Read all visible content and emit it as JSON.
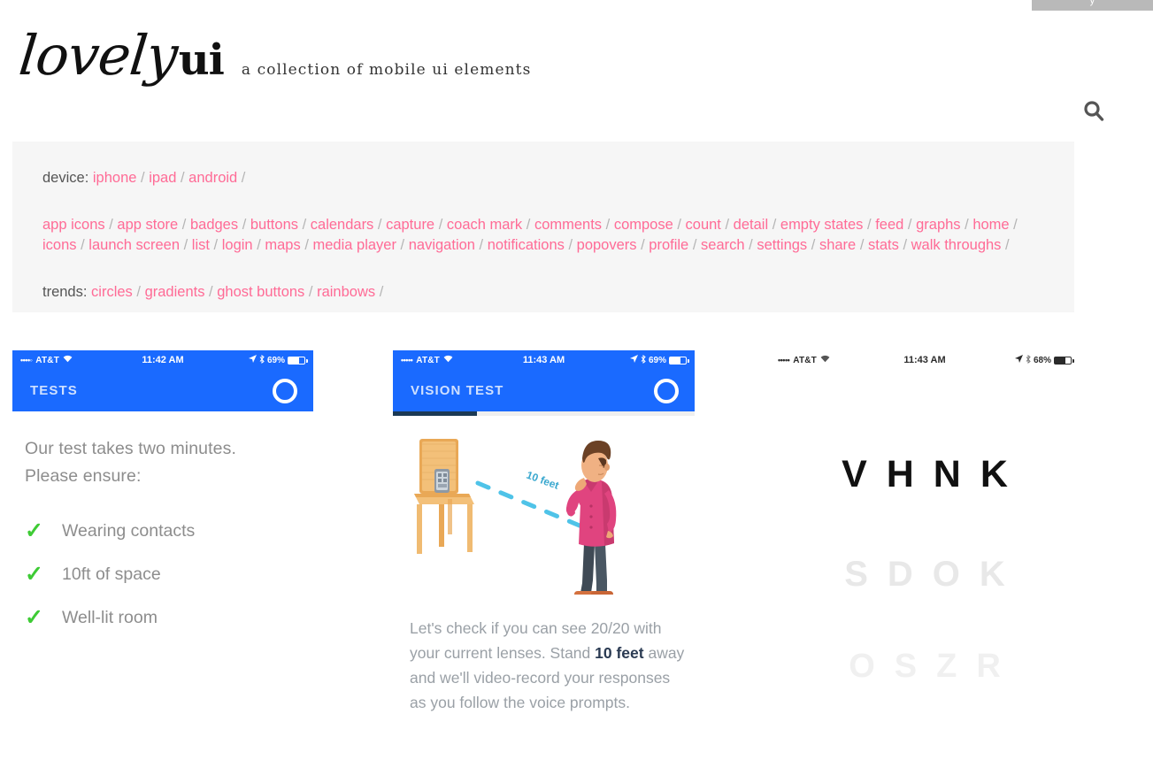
{
  "topbar": {
    "cut_label": "y"
  },
  "header": {
    "logo_script": "lovely",
    "logo_bold": "ui",
    "tagline": "a collection of mobile ui elements",
    "search_icon": "search-icon"
  },
  "nav": {
    "device_label": "device:",
    "device_links": [
      "iphone",
      "ipad",
      "android"
    ],
    "category_links": [
      "app icons",
      "app store",
      "badges",
      "buttons",
      "calendars",
      "capture",
      "coach mark",
      "comments",
      "compose",
      "count",
      "detail",
      "empty states",
      "feed",
      "graphs",
      "home",
      "icons",
      "launch screen",
      "list",
      "login",
      "maps",
      "media player",
      "navigation",
      "notifications",
      "popovers",
      "profile",
      "search",
      "settings",
      "share",
      "stats",
      "walk throughs"
    ],
    "trends_label": "trends:",
    "trend_links": [
      "circles",
      "gradients",
      "ghost buttons",
      "rainbows"
    ],
    "separator": "/",
    "link_color": "#ff6b96",
    "panel_bg": "#f6f6f6"
  },
  "shots": [
    {
      "id": "tests",
      "status": {
        "dots": "••••◦",
        "carrier": "AT&T",
        "wifi_icon": "wifi-icon",
        "time": "11:42 AM",
        "location_icon": "location-arrow-icon",
        "bluetooth_icon": "bluetooth-icon",
        "battery_pct": "69%",
        "battery_fill": 69
      },
      "navbar": {
        "title": "TESTS",
        "right_icon": "circle-ring-icon"
      },
      "intro_line_1": "Our test takes two minutes.",
      "intro_line_2": "Please ensure:",
      "checklist": [
        {
          "mark": "✓",
          "label": "Wearing contacts"
        },
        {
          "mark": "✓",
          "label": "10ft of space"
        },
        {
          "mark": "✓",
          "label": "Well-lit room"
        }
      ],
      "accent": "#1a6aff",
      "check_color": "#3ecb35"
    },
    {
      "id": "vision-test",
      "status": {
        "dots": "•••••",
        "carrier": "AT&T",
        "wifi_icon": "wifi-icon",
        "time": "11:43 AM",
        "location_icon": "location-arrow-icon",
        "bluetooth_icon": "bluetooth-icon",
        "battery_pct": "69%",
        "battery_fill": 69
      },
      "navbar": {
        "title": "VISION TEST",
        "right_icon": "circle-ring-icon"
      },
      "progress_pct": 28,
      "progress_color": "#1b3954",
      "illustration": {
        "name": "person-standing-10-feet-from-phone-on-chair",
        "distance_label": "10 feet",
        "dash_color": "#4fc3e8",
        "chair_color": "#f0b86a",
        "shirt_color": "#e0447f",
        "jeans_color": "#4a5763"
      },
      "caption_pre": "Let's check if you can see 20/20 with your current lenses. Stand ",
      "caption_bold": "10 feet",
      "caption_post": " away and we'll video-record your responses as you follow the voice prompts."
    },
    {
      "id": "eye-chart",
      "status": {
        "dots": "•••••",
        "carrier": "AT&T",
        "wifi_icon": "wifi-icon",
        "time": "11:43 AM",
        "location_icon": "location-arrow-icon",
        "bluetooth_icon": "bluetooth-icon",
        "battery_pct": "68%",
        "battery_fill": 68
      },
      "rows": [
        {
          "letters": "VHNK",
          "color": "#111111"
        },
        {
          "letters": "SDOK",
          "color": "#e8e8e8"
        },
        {
          "letters": "OSZR",
          "color": "#f0f0f0"
        }
      ]
    }
  ]
}
